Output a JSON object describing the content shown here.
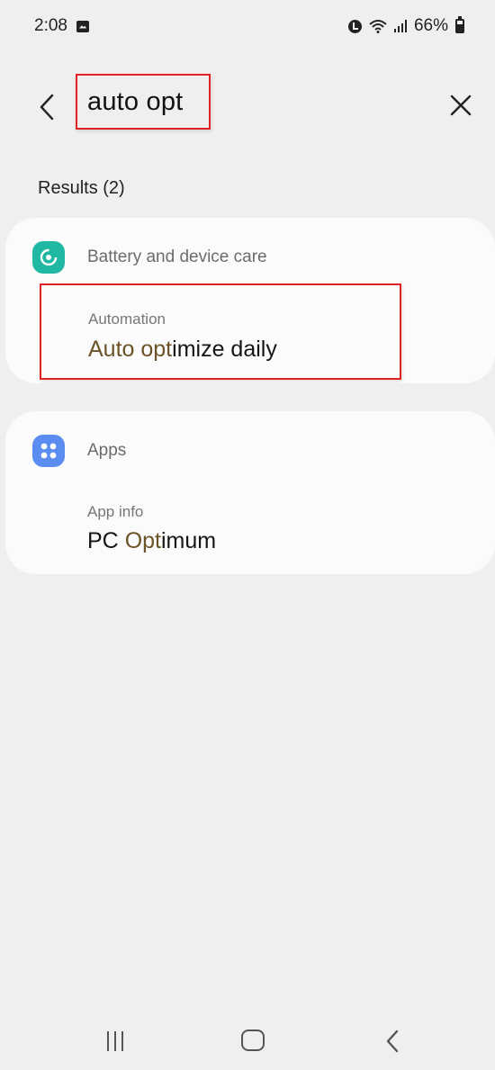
{
  "status_bar": {
    "time": "2:08",
    "battery_percent": "66%",
    "battery_level": 0.66,
    "icons": [
      "gallery-icon",
      "alarm-icon",
      "wifi-icon",
      "signal-icon",
      "battery-icon"
    ]
  },
  "header": {
    "search_query": "auto opt",
    "back_icon": "chevron-left-icon",
    "clear_icon": "close-icon"
  },
  "results": {
    "label": "Results (2)",
    "groups": [
      {
        "category": "Battery and device care",
        "icon": "device-care-icon",
        "icon_color": "#21b8a3",
        "items": [
          {
            "subtitle": "Automation",
            "title_match": "Auto opt",
            "title_rest": "imize daily"
          }
        ]
      },
      {
        "category": "Apps",
        "icon": "apps-icon",
        "icon_color": "#5b8cf0",
        "items": [
          {
            "subtitle": "App info",
            "title_prefix": "PC ",
            "title_match": "Opt",
            "title_rest": "imum"
          }
        ]
      }
    ]
  },
  "colors": {
    "background": "#f0efee",
    "card": "#fbfbfb",
    "match_highlight": "#6b5227",
    "annotation_box": "#e02222"
  },
  "nav_bar": {
    "icons": [
      "recents-icon",
      "home-icon",
      "back-icon"
    ]
  }
}
